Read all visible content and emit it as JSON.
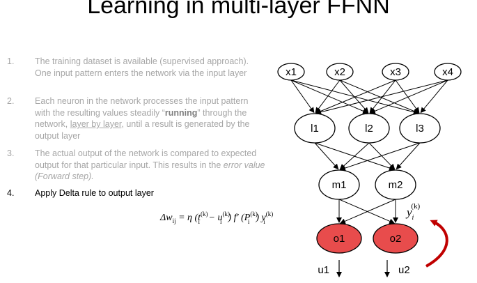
{
  "title": "Learning in multi-layer FFNN",
  "steps": [
    {
      "num": "1.",
      "parts": [
        {
          "t": "The training dataset is available (supervised approach).  One input pattern enters the network via the input layer"
        }
      ]
    },
    {
      "num": "2.",
      "parts": [
        {
          "t": "Each neuron in the network processes the input pattern with the resulting values steadily “"
        },
        {
          "t": "running",
          "bold": true
        },
        {
          "t": "” through the network, "
        },
        {
          "t": "layer by layer",
          "underline": true
        },
        {
          "t": ", until a result is generated by the output layer"
        }
      ]
    },
    {
      "num": "3.",
      "parts": [
        {
          "t": "The actual output of the network is compared to expected output for that particular input. This results in the "
        },
        {
          "t": "error value (Forward step).",
          "italic": true
        }
      ]
    },
    {
      "num": "4.",
      "parts": [
        {
          "t": "Apply Delta rule to output layer"
        }
      ]
    }
  ],
  "diagram": {
    "input_nodes": [
      "x1",
      "x2",
      "x3",
      "x4"
    ],
    "hidden1_nodes": [
      "l1",
      "l2",
      "l3"
    ],
    "hidden2_nodes": [
      "m1",
      "m2"
    ],
    "output_nodes": [
      "o1",
      "o2"
    ],
    "outputs": [
      "u1",
      "u2"
    ],
    "output_fill": "#e84c4c",
    "arrow_color": "#c00000"
  },
  "formula": {
    "delta_w": "Δw",
    "delta_w_sub": "ij",
    "eq": " = η (t",
    "t_sup": "(k)",
    "t_sub": "i",
    "minus": " − u",
    "u_sup": "(k)",
    "u_sub": "i",
    "close1": ") f′ (P",
    "p_sup": "(k)",
    "p_sub": "i",
    "close2": ") y",
    "y_sup": "(k)",
    "y_sub": "i"
  },
  "y_label": {
    "base": "y",
    "sub": "i",
    "sup": "(k)"
  }
}
